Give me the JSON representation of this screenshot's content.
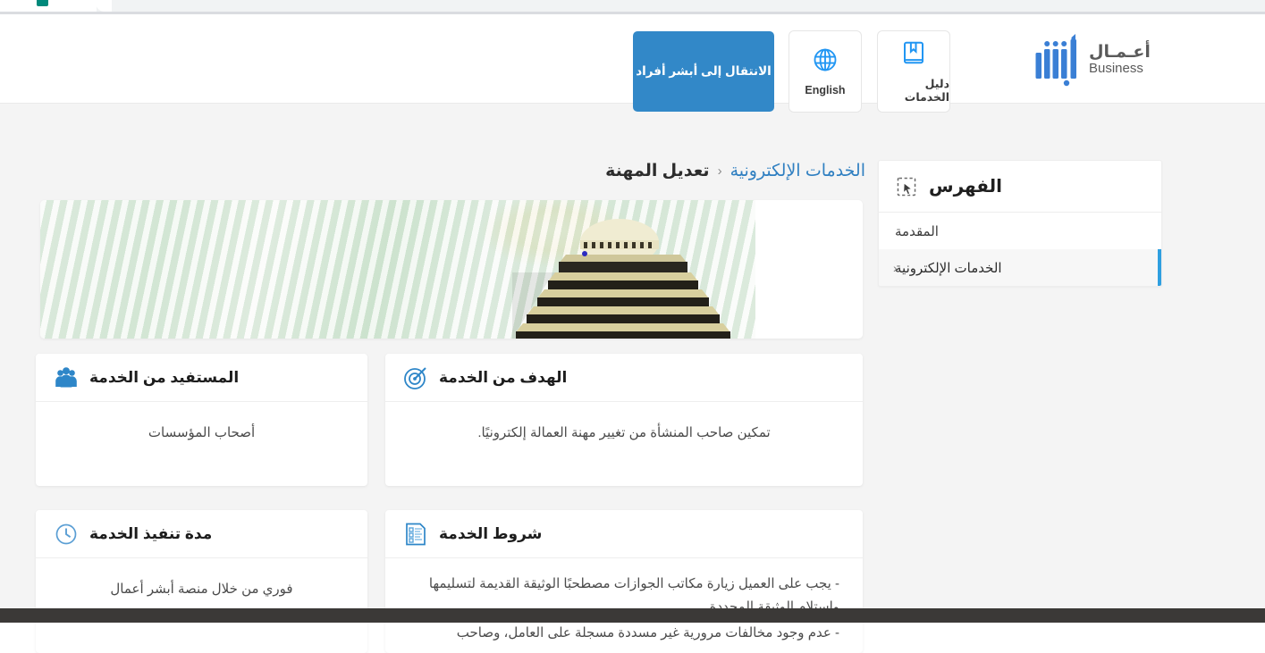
{
  "browser": {
    "favicon_color": "#00897b",
    "tabstrip_color": "#f1f3f4"
  },
  "header": {
    "logo": {
      "name": "absher-business-logo",
      "arabic_text": "أعـمـال",
      "english_text": "Business",
      "color": "#3a7fd5"
    },
    "buttons": [
      {
        "name": "service-guide-button",
        "label": "دليل الخدمات",
        "icon": "book-icon"
      },
      {
        "name": "language-button",
        "label": "English",
        "icon": "globe-icon"
      }
    ],
    "primary_button": {
      "name": "switch-to-absher-individuals-button",
      "label": "الانتقال إلى أبشر أفراد",
      "background": "#3288c8",
      "text_color": "#ffffff"
    }
  },
  "breadcrumb": {
    "parent_label": "الخدمات الإلكترونية",
    "separator": "‹",
    "current_label": "تعديل المهنة"
  },
  "index_panel": {
    "title": "الفهرس",
    "icon": "cursor-select-icon",
    "items": [
      {
        "label": "المقدمة",
        "active": false,
        "chevron": ""
      },
      {
        "label": "الخدمات الإلكترونية",
        "active": true,
        "chevron": "‹"
      }
    ],
    "active_accent": "#2f9fe0"
  },
  "hero": {
    "name": "service-hero-banner",
    "alt": "مبنى وزارة الداخلية",
    "carousel_dot_color": "#2b2bc0"
  },
  "cards": [
    {
      "id": "purpose",
      "icon": "target-icon",
      "title": "الهدف من الخدمة",
      "body": "تمكين صاحب المنشأة من تغيير مهنة العمالة إلكترونيًا."
    },
    {
      "id": "benefit",
      "icon": "users-group-icon",
      "title": "المستفيد من الخدمة",
      "body": "أصحاب المؤسسات"
    },
    {
      "id": "terms",
      "icon": "checklist-document-icon",
      "title": "شروط الخدمة",
      "bullets": [
        "- يجب على العميل زيارة مكاتب الجوازات مصطحبًا الوثيقة القديمة لتسليمها واستلام الوثيقة المجددة.",
        "- عدم وجود مخالفات مرورية غير مسددة مسجلة على العامل، وصاحب"
      ]
    },
    {
      "id": "duration",
      "icon": "clock-icon",
      "title": "مدة تنفيذ الخدمة",
      "body": "فوري من خلال منصة أبشر أعمال"
    }
  ],
  "theme": {
    "accent_blue": "#3288c8",
    "link_blue": "#2f7fc1",
    "page_background": "#f4f4f4",
    "card_background": "#ffffff",
    "bottom_bar": "#3b3937"
  }
}
